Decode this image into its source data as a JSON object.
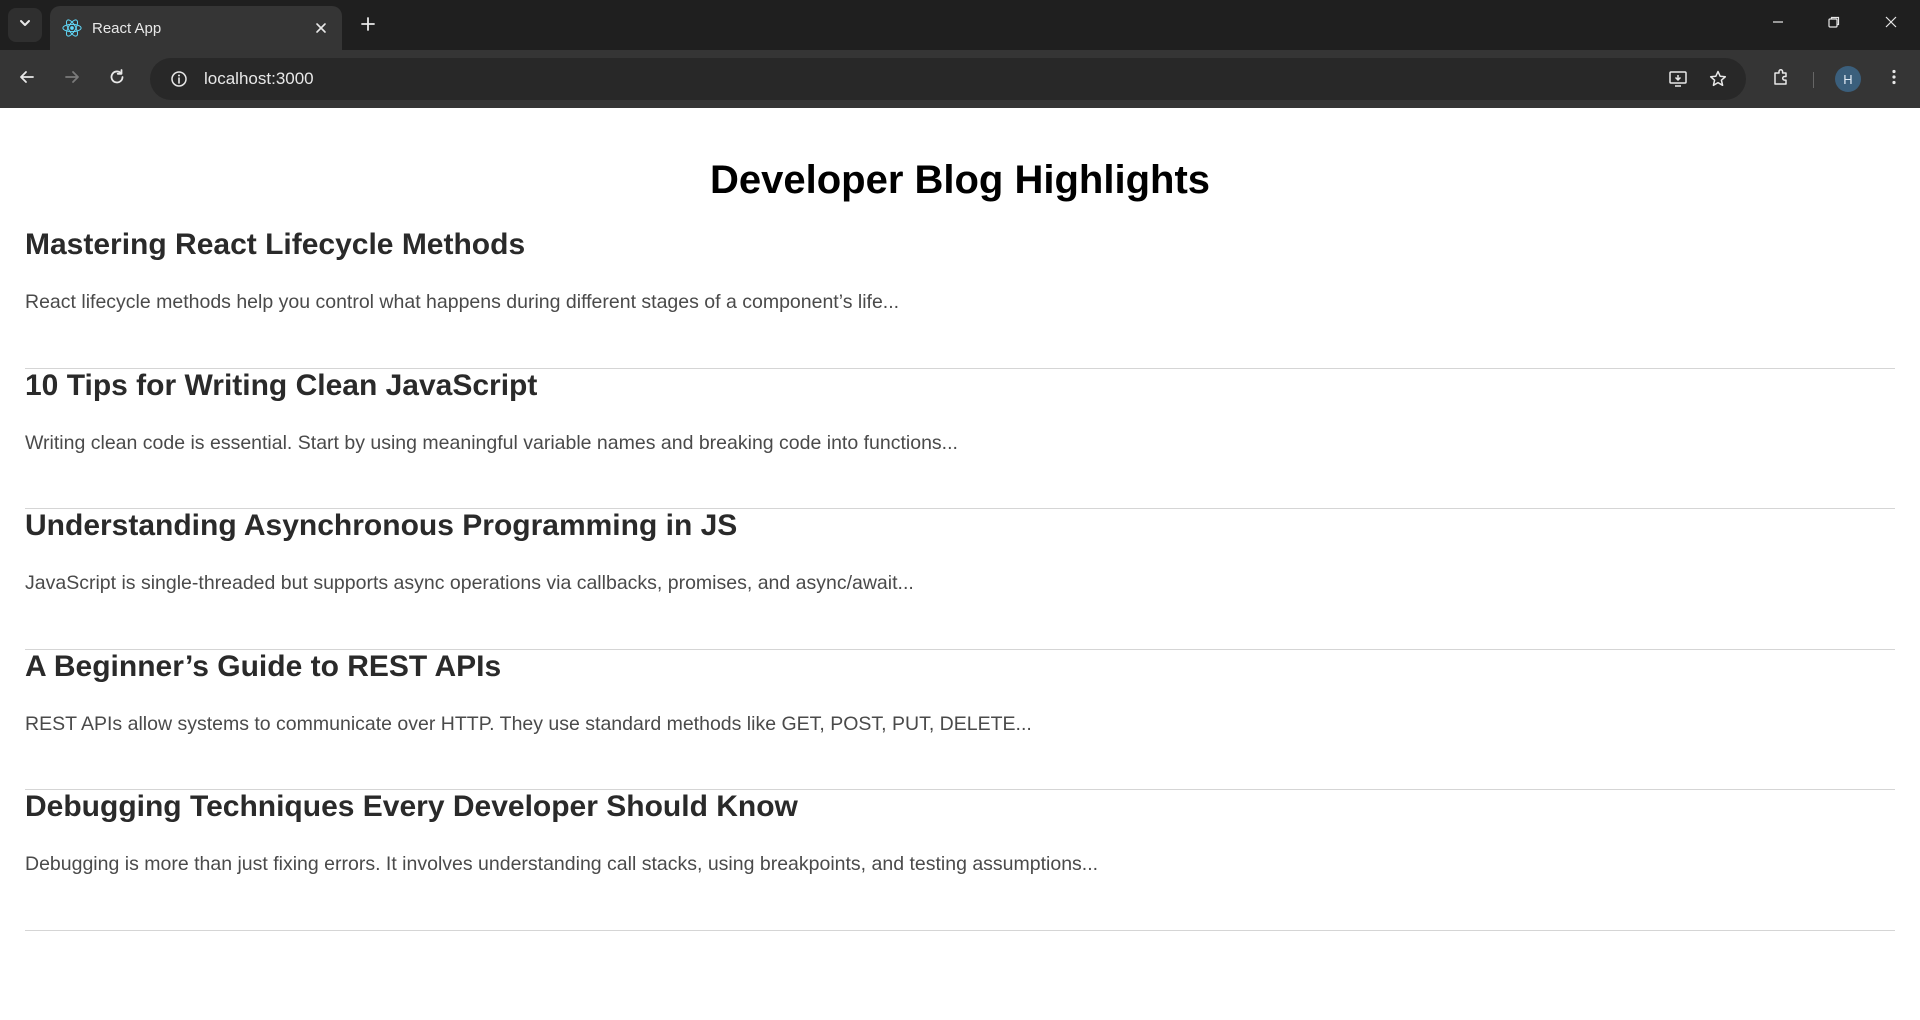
{
  "browser": {
    "tab_title": "React App",
    "url": "localhost:3000",
    "profile_initial": "H"
  },
  "page": {
    "title": "Developer Blog Highlights",
    "posts": [
      {
        "title": "Mastering React Lifecycle Methods",
        "excerpt": "React lifecycle methods help you control what happens during different stages of a component’s life..."
      },
      {
        "title": "10 Tips for Writing Clean JavaScript",
        "excerpt": "Writing clean code is essential. Start by using meaningful variable names and breaking code into functions..."
      },
      {
        "title": "Understanding Asynchronous Programming in JS",
        "excerpt": "JavaScript is single-threaded but supports async operations via callbacks, promises, and async/await..."
      },
      {
        "title": "A Beginner’s Guide to REST APIs",
        "excerpt": "REST APIs allow systems to communicate over HTTP. They use standard methods like GET, POST, PUT, DELETE..."
      },
      {
        "title": "Debugging Techniques Every Developer Should Know",
        "excerpt": "Debugging is more than just fixing errors. It involves understanding call stacks, using breakpoints, and testing assumptions..."
      }
    ]
  },
  "icons": {
    "tab_search": "chevron-down-icon",
    "favicon": "react-logo-icon",
    "tab_close": "close-icon",
    "new_tab": "plus-icon",
    "minimize": "minimize-icon",
    "restore": "restore-icon",
    "close_window": "close-icon",
    "back": "arrow-left-icon",
    "forward": "arrow-right-icon",
    "reload": "reload-icon",
    "site_info": "info-icon",
    "install": "install-app-icon",
    "bookmark": "star-icon",
    "extensions": "puzzle-icon",
    "menu": "kebab-menu-icon"
  },
  "colors": {
    "browser_frame": "#1f1f1f",
    "toolbar": "#353535",
    "omnibox": "#282828",
    "react_blue": "#61dafb",
    "divider": "#d5d5d5"
  }
}
